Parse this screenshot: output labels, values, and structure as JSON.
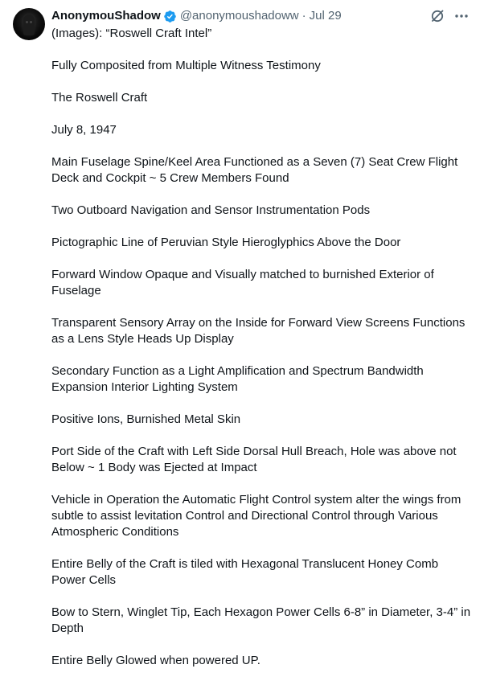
{
  "tweet": {
    "author": {
      "display_name": "AnonymouShadow",
      "handle": "@anonymoushadoww",
      "separator": "·",
      "date": "Jul 29",
      "verified": true
    },
    "icons": {
      "avatar": "avatar-image",
      "verified": "verified-badge-icon",
      "grok": "grok-icon",
      "more": "more-options-icon"
    },
    "colors": {
      "verified": "#1d9bf0",
      "text": "#0f1419",
      "secondary": "#536471"
    },
    "paragraphs": [
      "(Images): “Roswell Craft Intel”",
      "Fully Composited from Multiple Witness Testimony",
      "The Roswell Craft",
      "July 8, 1947",
      "Main Fuselage Spine/Keel Area Functioned as a Seven (7) Seat Crew Flight Deck and Cockpit ~ 5 Crew Members Found",
      "Two Outboard Navigation and Sensor Instrumentation Pods",
      "Pictographic Line of Peruvian Style Hieroglyphics Above the Door",
      "Forward Window Opaque and Visually matched to burnished Exterior of Fuselage",
      "Transparent Sensory Array on the Inside for Forward View Screens Functions as a Lens Style Heads Up Display",
      "Secondary Function as a Light Amplification and Spectrum Bandwidth Expansion Interior Lighting System",
      "Positive Ions, Burnished Metal Skin",
      "Port Side of the Craft with Left Side Dorsal Hull Breach, Hole was above not Below ~ 1 Body was Ejected at Impact",
      "Vehicle in Operation the Automatic Flight Control system alter the wings from subtle to assist levitation Control and Directional Control through Various Atmospheric Conditions",
      "Entire Belly of the Craft is tiled with Hexagonal Translucent Honey Comb Power Cells",
      "Bow to Stern, Winglet Tip, Each Hexagon Power Cells 6-8” in Diameter, 3-4” in Depth",
      "Entire Belly Glowed when powered UP."
    ]
  }
}
